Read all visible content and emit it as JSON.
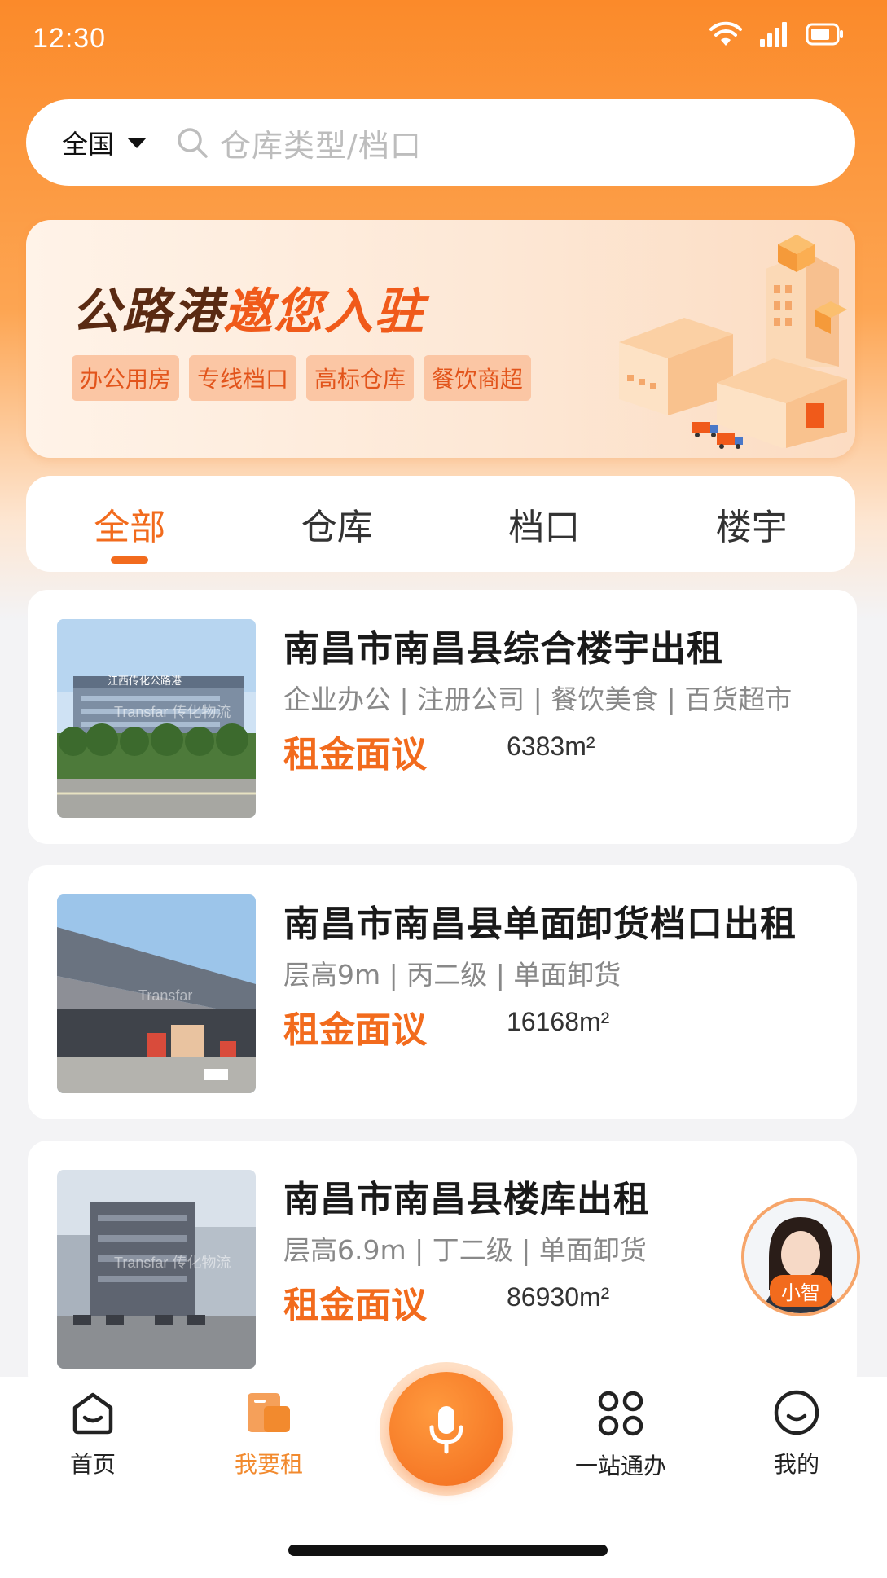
{
  "status_bar": {
    "time": "12:30"
  },
  "search": {
    "region": "全国",
    "placeholder": "仓库类型/档口"
  },
  "banner": {
    "title_dark": "公路港",
    "title_accent": "邀您入驻",
    "tags": [
      "办公用房",
      "专线档口",
      "高标仓库",
      "餐饮商超"
    ]
  },
  "tabs": [
    "全部",
    "仓库",
    "档口",
    "楼宇"
  ],
  "active_tab": "全部",
  "listings": [
    {
      "title": "南昌市南昌县综合楼宇出租",
      "tags": "企业办公 | 注册公司 | 餐饮美食 | 百货超市",
      "price": "租金面议",
      "area": "6383m²",
      "thumb_sign": "江西传化公路港",
      "thumb_watermark": "Transfar 传化物流"
    },
    {
      "title": "南昌市南昌县单面卸货档口出租",
      "tags": "层高9m | 丙二级 | 单面卸货",
      "price": "租金面议",
      "area": "16168m²",
      "thumb_watermark": "Transfar"
    },
    {
      "title": "南昌市南昌县楼库出租",
      "tags": "层高6.9m | 丁二级 | 单面卸货",
      "price": "租金面议",
      "area": "86930m²",
      "thumb_watermark": "Transfar 传化物流"
    }
  ],
  "assistant": {
    "label": "小智"
  },
  "bottom_nav": [
    {
      "label": "首页",
      "icon": "home-icon"
    },
    {
      "label": "我要租",
      "icon": "rent-icon",
      "active": true
    },
    {
      "label": "",
      "icon": "microphone-icon"
    },
    {
      "label": "一站通办",
      "icon": "apps-grid-icon"
    },
    {
      "label": "我的",
      "icon": "smiley-profile-icon"
    }
  ],
  "colors": {
    "accent": "#f26b1d",
    "banner_accent": "#f05a1a",
    "nav_active": "#f28a2e"
  }
}
